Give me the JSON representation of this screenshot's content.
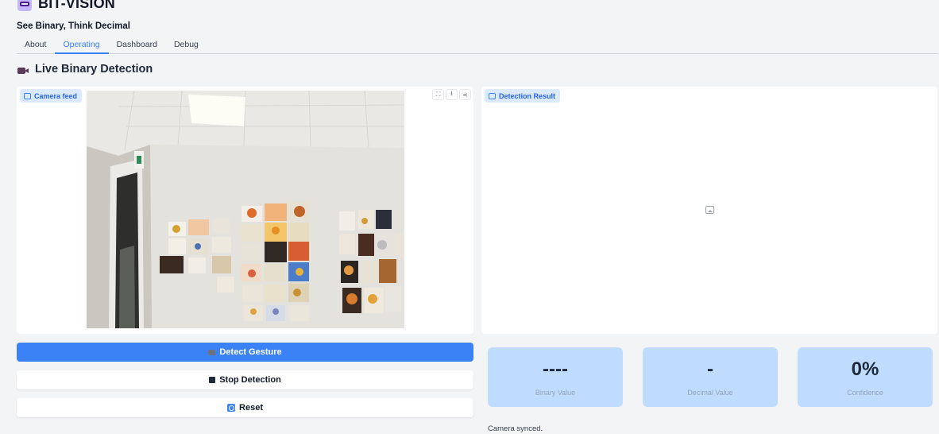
{
  "app": {
    "title": "BIT-VISION",
    "subtitle": "See Binary, Think Decimal"
  },
  "tabs": [
    {
      "label": "About"
    },
    {
      "label": "Operating"
    },
    {
      "label": "Dashboard"
    },
    {
      "label": "Debug"
    }
  ],
  "active_tab": "Operating",
  "section": {
    "title": "Live Binary Detection"
  },
  "camera_panel": {
    "label": "Camera feed",
    "actions": [
      "fullscreen-icon",
      "download-icon",
      "share-icon"
    ]
  },
  "result_panel": {
    "label": "Detection Result"
  },
  "buttons": {
    "detect": "Detect Gesture",
    "stop": "Stop Detection",
    "reset": "Reset"
  },
  "stats": [
    {
      "value": "----",
      "label": "Binary Value"
    },
    {
      "value": "-",
      "label": "Decimal Value"
    },
    {
      "value": "0%",
      "label": "Confidence"
    }
  ],
  "status": "Camera synced.",
  "colors": {
    "accent": "#3b82f6",
    "card": "#bfdbfe",
    "label_bg": "#dbeafe"
  }
}
